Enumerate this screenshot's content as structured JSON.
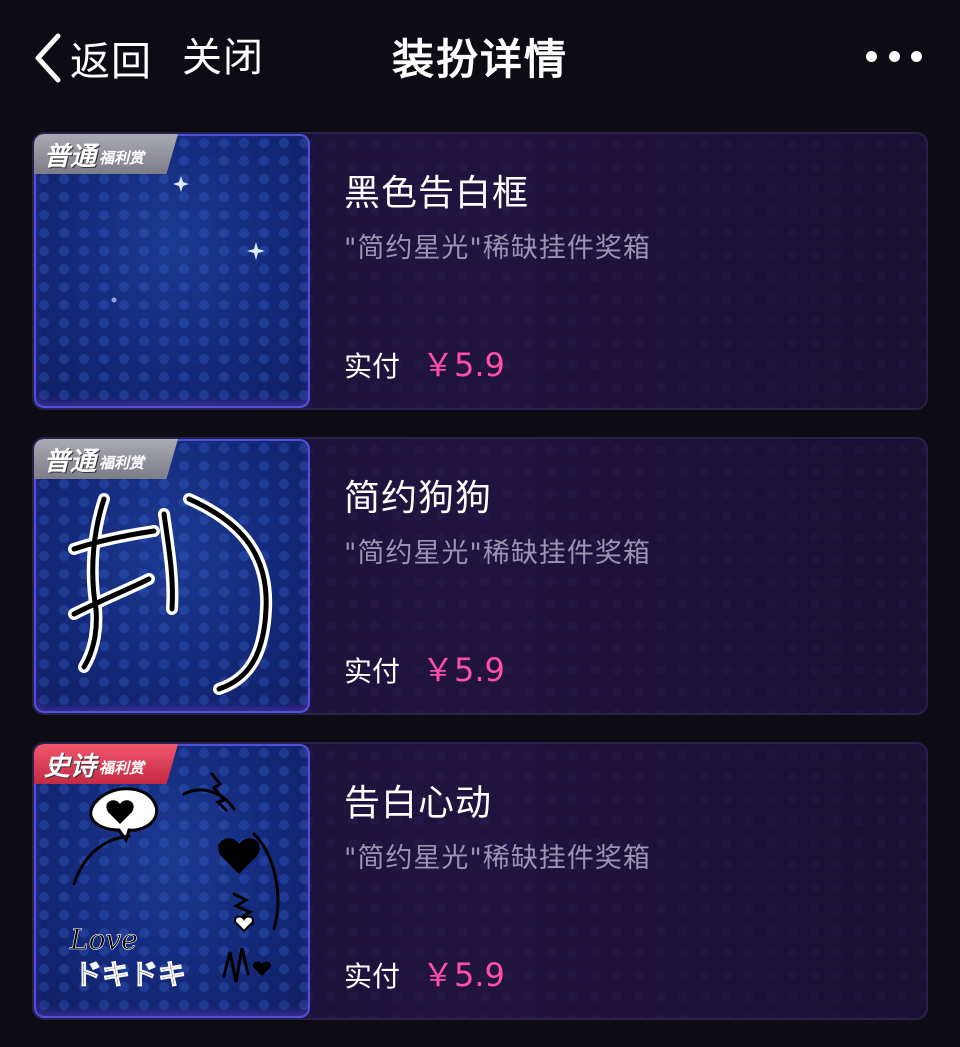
{
  "header": {
    "back_label": "返回",
    "close_label": "关闭",
    "title": "装扮详情"
  },
  "items": [
    {
      "badge_main": "普通",
      "badge_sub": "福利赏",
      "badge_color": "#8e8f98",
      "name": "黑色告白框",
      "desc": "\"简约星光\"稀缺挂件奖箱",
      "price_label": "实付",
      "price": "￥5.9",
      "thumb_icon": "sparkle-icon"
    },
    {
      "badge_main": "普通",
      "badge_sub": "福利赏",
      "badge_color": "#8e8f98",
      "name": "简约狗狗",
      "desc": "\"简约星光\"稀缺挂件奖箱",
      "price_label": "实付",
      "price": "￥5.9",
      "thumb_icon": "dog-doodle-icon"
    },
    {
      "badge_main": "史诗",
      "badge_sub": "福利赏",
      "badge_color": "#e43b56",
      "name": "告白心动",
      "desc": "\"简约星光\"稀缺挂件奖箱",
      "price_label": "实付",
      "price": "￥5.9",
      "thumb_icon": "love-doki-doodle-icon",
      "thumb_text_1": "Love",
      "thumb_text_2": "ドキドキ"
    }
  ],
  "colors": {
    "background": "#0d0b14",
    "price": "#ff4fa8",
    "desc": "#9b94b4"
  }
}
